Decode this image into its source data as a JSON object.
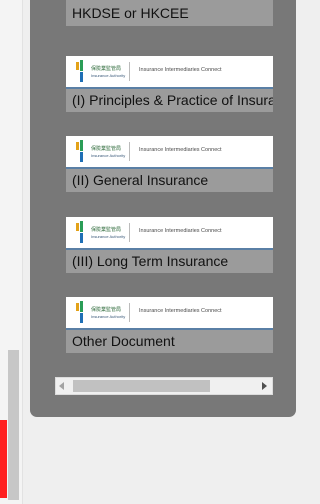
{
  "documents": [
    {
      "label": "HKDSE or HKCEE",
      "has_logo": false
    },
    {
      "label": "(I) Principles & Practice of Insurance",
      "has_logo": true
    },
    {
      "label": "(II) General Insurance",
      "has_logo": true
    },
    {
      "label": "(III) Long Term Insurance",
      "has_logo": true
    },
    {
      "label": "Other Document",
      "has_logo": true
    }
  ],
  "logo": {
    "org_cn": "保險業監管局",
    "org_en": "Insurance Authority",
    "caption": "Insurance Intermediaries Connect"
  },
  "colors": {
    "panel": "#787878",
    "label_bg": "#9b9b9b",
    "marker": "#ff1f1f",
    "logo_accent": "#5a7fa5"
  }
}
